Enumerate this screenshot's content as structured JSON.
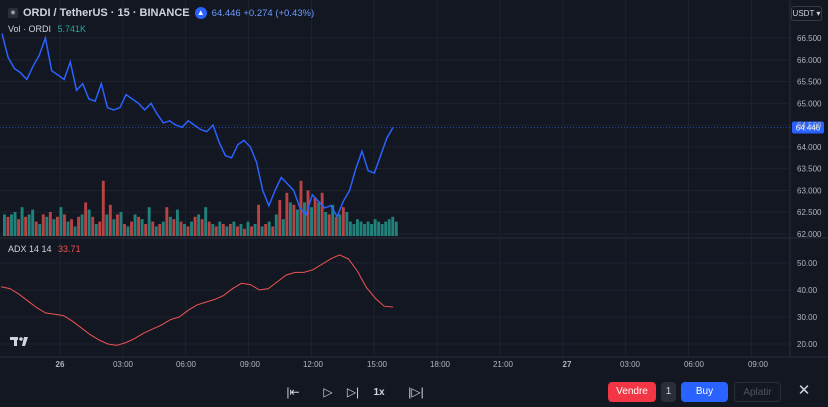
{
  "header": {
    "symbol": "ORDI / TetherUS · 15 · BINANCE",
    "price_change": "64.446 +0.274 (+0.43%)"
  },
  "volume_legend": {
    "label": "Vol · ORDI",
    "value": "5.741K"
  },
  "adx_legend": {
    "label": "ADX 14 14",
    "value": "33.71"
  },
  "currency_button": "USDT",
  "current_price_label": "64.446",
  "price_axis": [
    "66.500",
    "66.000",
    "65.500",
    "65.000",
    "64.500",
    "64.000",
    "63.500",
    "63.000",
    "62.500",
    "62.000"
  ],
  "adx_axis": [
    "50.00",
    "40.00",
    "30.00",
    "20.00"
  ],
  "time_axis": [
    "26",
    "03:00",
    "06:00",
    "09:00",
    "12:00",
    "15:00",
    "18:00",
    "21:00",
    "27",
    "03:00",
    "06:00",
    "09:00"
  ],
  "toolbar": {
    "sell_label": "Vendre",
    "quantity": "1",
    "buy_label": "Buy",
    "flatten_label": "Aplatir",
    "speed": "1x"
  },
  "colors": {
    "background": "#131722",
    "price_line": "#2962ff",
    "volume_up": "#26a69a",
    "volume_down": "#ef5350",
    "adx_line": "#ef5350",
    "sell": "#f23645",
    "buy": "#2962ff"
  },
  "chart_data": [
    {
      "type": "line",
      "title": "ORDI / TetherUS · 15 · BINANCE",
      "x_range": [
        "26 00:00",
        "27 09:00"
      ],
      "ylim": [
        62.0,
        66.6
      ],
      "series": [
        {
          "name": "ORDI / TetherUS",
          "x_hours": [
            0,
            0.25,
            0.5,
            0.75,
            1,
            1.25,
            1.5,
            1.75,
            2,
            2.25,
            2.5,
            2.75,
            3,
            3.25,
            3.5,
            3.75,
            4,
            4.25,
            4.5,
            4.75,
            5,
            5.25,
            5.5,
            5.75,
            6,
            6.25,
            6.5,
            6.75,
            7,
            7.25,
            7.5,
            7.75,
            8,
            8.25,
            8.5,
            8.75,
            9,
            9.25,
            9.5,
            9.75,
            10,
            10.25,
            10.5,
            10.75,
            11,
            11.25,
            11.5,
            11.75,
            12,
            12.25,
            12.5,
            12.75,
            13,
            13.25,
            13.5,
            13.75,
            14,
            14.25,
            14.5,
            14.75,
            15,
            15.25,
            15.5,
            15.75
          ],
          "values": [
            66.6,
            66.05,
            65.8,
            65.7,
            65.55,
            65.85,
            66.1,
            66.5,
            65.75,
            65.65,
            65.55,
            65.95,
            65.3,
            65.45,
            65.1,
            65.05,
            65.45,
            64.9,
            64.85,
            64.9,
            65.2,
            65.1,
            65.0,
            64.85,
            65.0,
            64.75,
            64.55,
            64.6,
            64.5,
            64.45,
            64.6,
            64.5,
            64.4,
            64.35,
            64.5,
            64.1,
            63.8,
            63.75,
            64.05,
            64.15,
            64.0,
            63.65,
            63.0,
            62.65,
            63.0,
            63.3,
            63.15,
            63.0,
            62.6,
            62.45,
            62.9,
            62.75,
            62.6,
            62.65,
            62.4,
            62.75,
            63.0,
            63.5,
            63.9,
            63.45,
            63.4,
            63.8,
            64.2,
            64.446
          ]
        }
      ]
    },
    {
      "type": "bar",
      "title": "Vol · ORDI",
      "series": [
        {
          "name": "Vol · ORDI",
          "values": [
            0.9,
            0.8,
            0.9,
            1.0,
            0.7,
            1.2,
            0.8,
            0.9,
            1.1,
            0.6,
            0.5,
            0.9,
            0.8,
            1.0,
            0.7,
            0.8,
            1.2,
            0.9,
            0.6,
            0.7,
            0.4,
            0.8,
            0.9,
            1.4,
            1.1,
            0.8,
            0.5,
            0.6,
            2.3,
            0.9,
            1.3,
            0.7,
            0.9,
            1.0,
            0.5,
            0.4,
            0.6,
            0.9,
            0.8,
            0.7,
            0.5,
            1.2,
            0.6,
            0.4,
            0.5,
            0.6,
            1.2,
            0.8,
            0.7,
            1.1,
            0.6,
            0.5,
            0.4,
            0.6,
            0.8,
            0.9,
            0.7,
            1.2,
            0.6,
            0.5,
            0.4,
            0.6,
            0.5,
            0.4,
            0.5,
            0.6,
            0.4,
            0.5,
            0.3,
            0.6,
            0.4,
            0.5,
            1.3,
            0.4,
            0.5,
            0.6,
            0.4,
            0.9,
            1.5,
            0.7,
            1.8,
            1.4,
            1.3,
            1.1,
            2.3,
            1.4,
            1.9,
            1.2,
            1.6,
            1.4,
            1.8,
            1.0,
            0.9,
            1.3,
            0.8,
            0.9,
            1.2,
            1.0,
            0.6,
            0.5,
            0.7,
            0.6,
            0.5,
            0.6,
            0.5,
            0.7,
            0.6,
            0.5,
            0.6,
            0.7,
            0.8,
            0.6
          ],
          "up": [
            1,
            0,
            1,
            1,
            0,
            1,
            0,
            1,
            1,
            0,
            1,
            0,
            1,
            0,
            1,
            0,
            1,
            0,
            1,
            0,
            1,
            0,
            1,
            0,
            1,
            0,
            1,
            0,
            0,
            1,
            0,
            1,
            0,
            1,
            0,
            1,
            0,
            1,
            0,
            1,
            0,
            1,
            0,
            1,
            0,
            1,
            0,
            1,
            0,
            1,
            0,
            1,
            0,
            1,
            0,
            1,
            0,
            1,
            0,
            1,
            0,
            1,
            0,
            1,
            0,
            1,
            0,
            1,
            0,
            1,
            0,
            1,
            0,
            1,
            0,
            1,
            0,
            1,
            0,
            1,
            0,
            1,
            0,
            1,
            0,
            1,
            0,
            1,
            0,
            1,
            0,
            1,
            0,
            1,
            0,
            1,
            0,
            1,
            1,
            1,
            1,
            1,
            1,
            1,
            1,
            1,
            1,
            1,
            1,
            1,
            1,
            1
          ]
        }
      ]
    },
    {
      "type": "line",
      "title": "ADX 14 14",
      "ylim": [
        18,
        54
      ],
      "series": [
        {
          "name": "ADX",
          "x_hours": [
            0,
            0.5,
            1,
            1.5,
            2,
            2.5,
            3,
            3.5,
            4,
            4.5,
            5,
            5.5,
            6,
            6.5,
            7,
            7.5,
            8,
            8.5,
            9,
            9.5,
            10,
            10.5,
            11,
            11.5,
            12,
            12.5,
            13,
            13.5,
            14,
            14.5,
            15,
            15.5,
            15.75
          ],
          "values": [
            41.2,
            40.5,
            38.5,
            36,
            33.5,
            31.5,
            31,
            30.5,
            28.5,
            26,
            23.5,
            21.5,
            20,
            19.5,
            20.5,
            22,
            24,
            25.5,
            27,
            29,
            30,
            32.5,
            34.5,
            35.5,
            36.5,
            38,
            40.5,
            42.5,
            42,
            40,
            40.5,
            43,
            45.5,
            46.5,
            46.5,
            47.5,
            49.5,
            51.5,
            53,
            51.5,
            47,
            41,
            37,
            34,
            33.71
          ]
        }
      ]
    }
  ]
}
